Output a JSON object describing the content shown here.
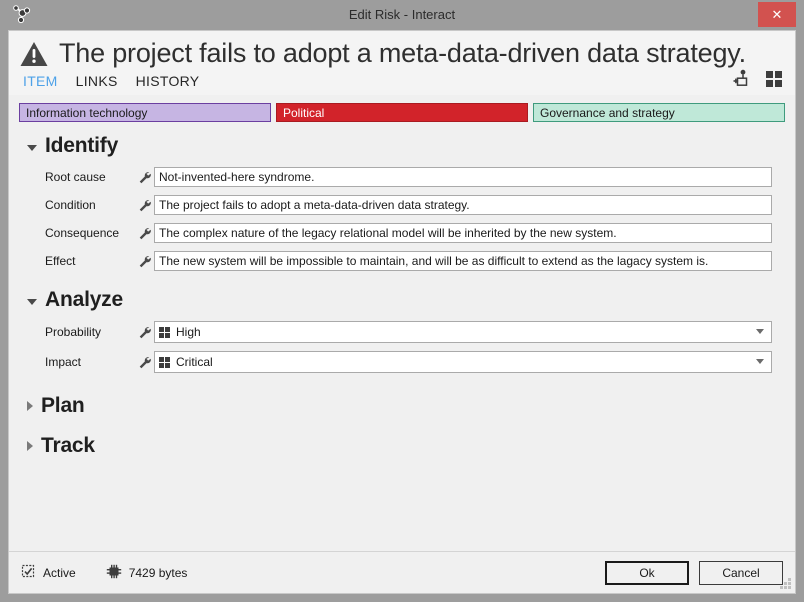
{
  "window": {
    "title": "Edit Risk - Interact",
    "app_icon": "molecule-network-icon",
    "close_label": "✕"
  },
  "header": {
    "warning_icon": "warning-triangle-icon",
    "page_title": "The project fails to adopt a meta-data-driven data strategy.",
    "tabs": [
      {
        "label": "ITEM",
        "active": true
      },
      {
        "label": "LINKS",
        "active": false
      },
      {
        "label": "HISTORY",
        "active": false
      }
    ],
    "tools": [
      {
        "name": "add-node-icon"
      },
      {
        "name": "grid-view-icon"
      }
    ]
  },
  "categories": [
    {
      "label": "Information technology",
      "bg": "#c6b5e3",
      "border": "#6b3fa0",
      "text": "#1a1a1a"
    },
    {
      "label": "Political",
      "bg": "#d2232a",
      "border": "#a91b21",
      "text": "#ffffff"
    },
    {
      "label": "Governance and strategy",
      "bg": "#bfe8d8",
      "border": "#3f9b7d",
      "text": "#1a1a1a"
    }
  ],
  "sections": [
    {
      "title": "Identify",
      "expanded": true,
      "fields": [
        {
          "label": "Root cause",
          "type": "text",
          "value": "Not-invented-here syndrome.",
          "icon": "wrench-icon"
        },
        {
          "label": "Condition",
          "type": "text",
          "value": "The project fails to adopt a meta-data-driven data strategy.",
          "icon": "wrench-icon"
        },
        {
          "label": "Consequence",
          "type": "text",
          "value": "The complex nature of the legacy relational model will be inherited by the new system.",
          "icon": "wrench-icon"
        },
        {
          "label": "Effect",
          "type": "text",
          "value": "The new system will be impossible to maintain, and will be as difficult to extend as the lagacy system is.",
          "icon": "wrench-icon"
        }
      ]
    },
    {
      "title": "Analyze",
      "expanded": true,
      "fields": [
        {
          "label": "Probability",
          "type": "select",
          "value": "High",
          "icon": "wrench-icon",
          "value_icon": "grid-icon"
        },
        {
          "label": "Impact",
          "type": "select",
          "value": "Critical",
          "icon": "wrench-icon",
          "value_icon": "grid-icon"
        }
      ]
    },
    {
      "title": "Plan",
      "expanded": false,
      "fields": []
    },
    {
      "title": "Track",
      "expanded": false,
      "fields": []
    }
  ],
  "footer": {
    "status_icon": "document-check-icon",
    "status_label": "Active",
    "size_icon": "memory-chip-icon",
    "size_label": "7429 bytes",
    "ok_label": "Ok",
    "cancel_label": "Cancel"
  }
}
